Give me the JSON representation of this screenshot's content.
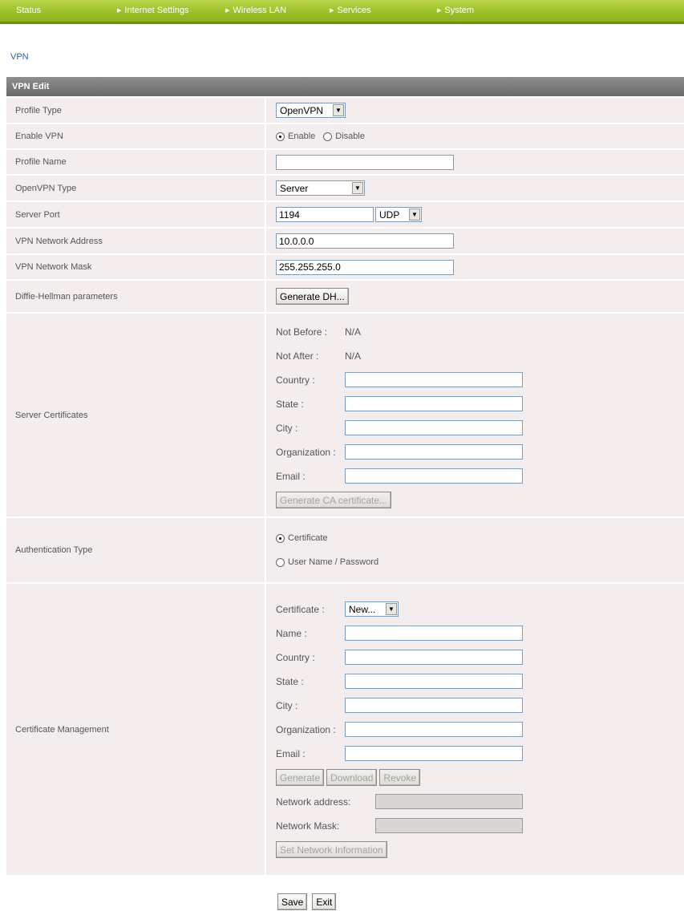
{
  "nav": {
    "items": [
      "Status",
      "Internet Settings",
      "Wireless LAN",
      "Services",
      "System"
    ]
  },
  "page_link": "VPN",
  "form": {
    "title": "VPN Edit",
    "profile_type": {
      "label": "Profile Type",
      "value": "OpenVPN"
    },
    "enable_vpn": {
      "label": "Enable VPN",
      "enable": "Enable",
      "disable": "Disable"
    },
    "profile_name": {
      "label": "Profile Name",
      "value": ""
    },
    "openvpn_type": {
      "label": "OpenVPN Type",
      "value": "Server"
    },
    "server_port": {
      "label": "Server Port",
      "value": "1194",
      "protocol": "UDP"
    },
    "network_address": {
      "label": "VPN Network Address",
      "value": "10.0.0.0"
    },
    "network_mask": {
      "label": "VPN Network Mask",
      "value": "255.255.255.0"
    },
    "dh": {
      "label": "Diffie-Hellman parameters",
      "button": "Generate DH..."
    },
    "server_certs": {
      "label": "Server Certificates",
      "not_before_label": "Not Before :",
      "not_before": "N/A",
      "not_after_label": "Not After :",
      "not_after": "N/A",
      "country": "Country :",
      "state": "State :",
      "city": "City :",
      "organization": "Organization :",
      "email": "Email :",
      "button": "Generate CA certificate..."
    },
    "auth_type": {
      "label": "Authentication Type",
      "certificate": "Certificate",
      "userpass": "User Name / Password"
    },
    "cert_mgmt": {
      "label": "Certificate Management",
      "certificate_label": "Certificate :",
      "certificate_value": "New...",
      "name": "Name :",
      "country": "Country :",
      "state": "State :",
      "city": "City :",
      "organization": "Organization :",
      "email": "Email :",
      "generate": "Generate",
      "download": "Download",
      "revoke": "Revoke",
      "net_addr": "Network address:",
      "net_mask": "Network Mask:",
      "set_net": "Set Network Information"
    }
  },
  "footer": {
    "save": "Save",
    "exit": "Exit"
  }
}
